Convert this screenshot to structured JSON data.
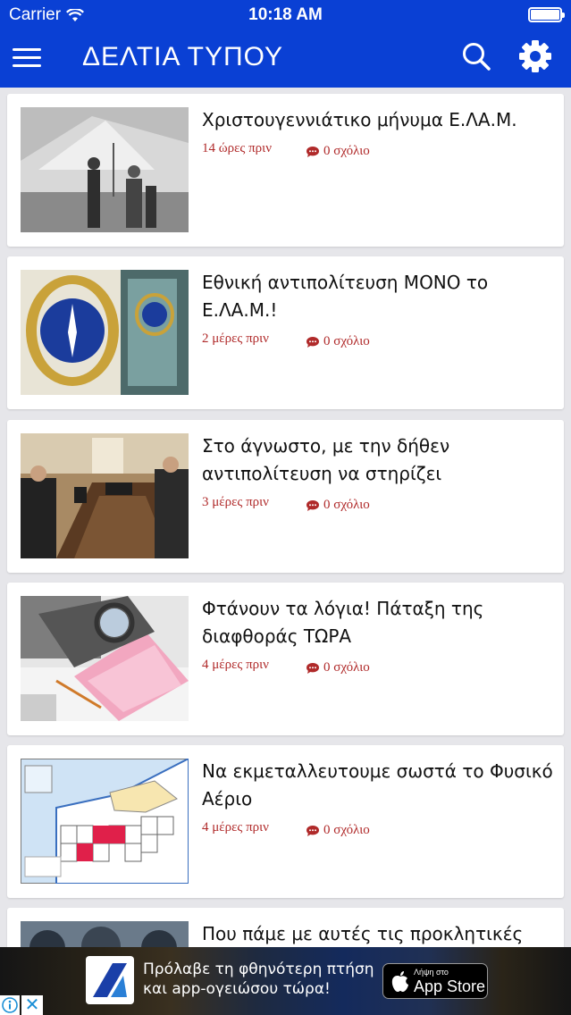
{
  "status_bar": {
    "carrier": "Carrier",
    "time": "10:18 AM"
  },
  "nav": {
    "title": "ΔΕΛΤΙΑ ΤΥΠΟΥ"
  },
  "colors": {
    "nav_blue": "#0a40d4",
    "meta_red": "#b02a2a",
    "background": "#e6e6ea"
  },
  "articles": [
    {
      "title": "Χριστουγεννιάτικο μήνυμα Ε.ΛΑ.Μ.",
      "time": "14 ώρες πριν",
      "comments": "0 σχόλιο"
    },
    {
      "title": "Εθνική αντιπολίτευση ΜΟΝΟ το Ε.ΛΑ.Μ.!",
      "time": "2 μέρες πριν",
      "comments": "0 σχόλιο"
    },
    {
      "title": "Στο άγνωστο, με την δήθεν αντιπολίτευση να στηρίζει",
      "time": "3 μέρες πριν",
      "comments": "0 σχόλιο"
    },
    {
      "title": "Φτάνουν τα λόγια! Πάταξη της διαφθοράς ΤΩΡΑ",
      "time": "4 μέρες πριν",
      "comments": "0 σχόλιο"
    },
    {
      "title": "Να εκμεταλλευτουμε σωστά το Φυσικό Αέριο",
      "time": "4 μέρες πριν",
      "comments": "0 σχόλιο"
    },
    {
      "title": "Που πάμε με αυτές τις προκλητικές",
      "time": "",
      "comments": ""
    }
  ],
  "ad": {
    "line1": "Πρόλαβε τη φθηνότερη πτήση",
    "line2": "και app-ογειώσου τώρα!",
    "store_small": "Λήψη στο",
    "store_big": "App Store",
    "close": "✕"
  },
  "icons": [
    "wifi-icon",
    "battery-icon",
    "menu-icon",
    "search-icon",
    "gear-icon",
    "comment-icon",
    "apple-icon",
    "info-icon",
    "close-icon"
  ]
}
